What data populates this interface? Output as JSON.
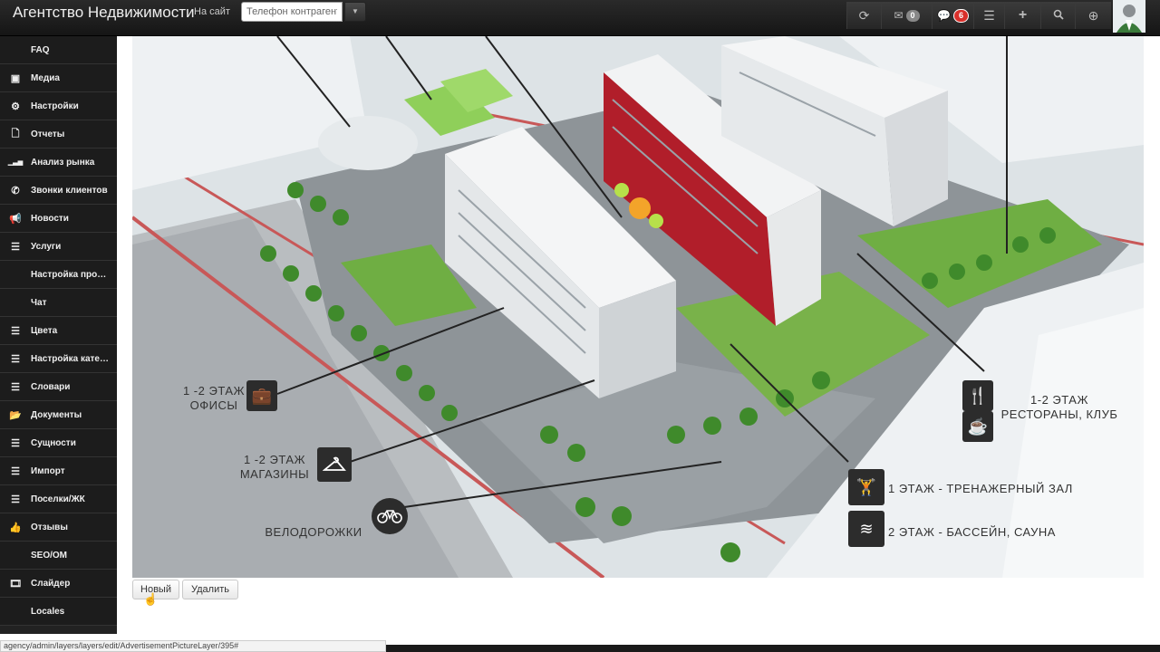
{
  "header": {
    "brand": "Агентство Недвижимости",
    "onsite_link": "На сайт",
    "phone_placeholder": "Телефон контрагент",
    "mail_count": "0",
    "notif_count": "6"
  },
  "sidebar": {
    "items": [
      {
        "label": "FAQ",
        "icon": "none"
      },
      {
        "label": "Медиа",
        "icon": "picture-icon"
      },
      {
        "label": "Настройки",
        "icon": "gear-icon"
      },
      {
        "label": "Отчеты",
        "icon": "file-icon"
      },
      {
        "label": "Анализ рынка",
        "icon": "signal-icon"
      },
      {
        "label": "Звонки клиентов",
        "icon": "phone-icon"
      },
      {
        "label": "Новости",
        "icon": "megaphone-icon"
      },
      {
        "label": "Услуги",
        "icon": "list-icon"
      },
      {
        "label": "Настройка профиля",
        "icon": "none"
      },
      {
        "label": "Чат",
        "icon": "none"
      },
      {
        "label": "Цвета",
        "icon": "list-icon"
      },
      {
        "label": "Настройка категорий",
        "icon": "list-icon"
      },
      {
        "label": "Словари",
        "icon": "list-icon"
      },
      {
        "label": "Документы",
        "icon": "folder-icon"
      },
      {
        "label": "Сущности",
        "icon": "list-icon"
      },
      {
        "label": "Импорт",
        "icon": "list-icon"
      },
      {
        "label": "Поселки/ЖК",
        "icon": "list-icon"
      },
      {
        "label": "Отзывы",
        "icon": "thumbs-up-icon"
      },
      {
        "label": "SEO/OM",
        "icon": "none"
      },
      {
        "label": "Слайдер",
        "icon": "film-icon"
      },
      {
        "label": "Locales",
        "icon": "none"
      }
    ]
  },
  "image_labels": {
    "offices_floor": "1 -2 ЭТАЖ",
    "offices": "ОФИСЫ",
    "shops_floor": "1 -2 ЭТАЖ",
    "shops": "МАГАЗИНЫ",
    "bike": "ВЕЛОДОРОЖКИ",
    "restaurants_floor": "1-2 ЭТАЖ",
    "restaurants": "РЕСТОРАНЫ, КЛУБ",
    "gym": "1 ЭТАЖ - ТРЕНАЖЕРНЫЙ ЗАЛ",
    "pool": "2 ЭТАЖ - БАССЕЙН, САУНА"
  },
  "actions": {
    "new_label": "Новый",
    "delete_label": "Удалить"
  },
  "status_url": "agency/admin/layers/layers/edit/AdvertisementPictureLayer/395#"
}
